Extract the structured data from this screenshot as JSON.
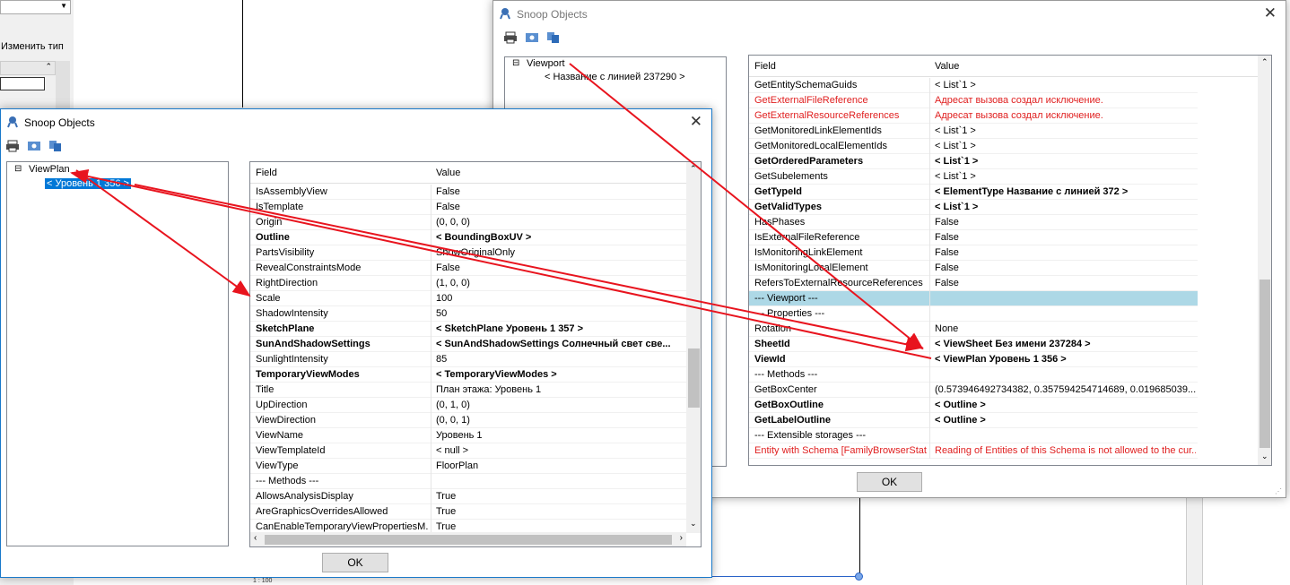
{
  "background": {
    "change_type_label": "Изменить тип",
    "scale_label": "1 : 100"
  },
  "left_window": {
    "title": "Snoop Objects",
    "close": "✕",
    "tree": {
      "root": "ViewPlan",
      "child": "< Уровень 1  356 >",
      "expander": "⊟"
    },
    "headers": {
      "field": "Field",
      "value": "Value"
    },
    "rows": [
      {
        "f": "IsAssemblyView",
        "v": "False",
        "style": ""
      },
      {
        "f": "IsTemplate",
        "v": "False",
        "style": ""
      },
      {
        "f": "Origin",
        "v": "(0, 0, 0)",
        "style": ""
      },
      {
        "f": "Outline",
        "v": "< BoundingBoxUV >",
        "style": "bold"
      },
      {
        "f": "PartsVisibility",
        "v": "ShowOriginalOnly",
        "style": ""
      },
      {
        "f": "RevealConstraintsMode",
        "v": "False",
        "style": ""
      },
      {
        "f": "RightDirection",
        "v": "(1, 0, 0)",
        "style": ""
      },
      {
        "f": "Scale",
        "v": "100",
        "style": ""
      },
      {
        "f": "ShadowIntensity",
        "v": "50",
        "style": ""
      },
      {
        "f": "SketchPlane",
        "v": "< SketchPlane  Уровень 1    357 >",
        "style": "bold"
      },
      {
        "f": "SunAndShadowSettings",
        "v": "< SunAndShadowSettings  Солнечный свет све...",
        "style": "bold"
      },
      {
        "f": "SunlightIntensity",
        "v": "85",
        "style": ""
      },
      {
        "f": "TemporaryViewModes",
        "v": "< TemporaryViewModes >",
        "style": "bold"
      },
      {
        "f": "Title",
        "v": "План этажа: Уровень 1",
        "style": ""
      },
      {
        "f": "UpDirection",
        "v": "(0, 1, 0)",
        "style": ""
      },
      {
        "f": "ViewDirection",
        "v": "(0, 0, 1)",
        "style": ""
      },
      {
        "f": "ViewName",
        "v": "Уровень 1",
        "style": ""
      },
      {
        "f": "ViewTemplateId",
        "v": "< null >",
        "style": ""
      },
      {
        "f": "ViewType",
        "v": "FloorPlan",
        "style": ""
      },
      {
        "f": "--- Methods ---",
        "v": "",
        "style": "section"
      },
      {
        "f": "AllowsAnalysisDisplay",
        "v": "True",
        "style": ""
      },
      {
        "f": "AreGraphicsOverridesAllowed",
        "v": "True",
        "style": ""
      },
      {
        "f": "CanEnableTemporaryViewPropertiesM...",
        "v": "True",
        "style": ""
      }
    ],
    "ok_label": "OK"
  },
  "right_window": {
    "title": "Snoop Objects",
    "close": "✕",
    "tree": {
      "root": "Viewport",
      "child": "< Название с линией  237290 >",
      "expander": "⊟"
    },
    "headers": {
      "field": "Field",
      "value": "Value"
    },
    "rows": [
      {
        "f": "GetEntitySchemaGuids",
        "v": "< List`1 >",
        "style": ""
      },
      {
        "f": "GetExternalFileReference",
        "v": "Адресат вызова создал исключение.",
        "style": "red"
      },
      {
        "f": "GetExternalResourceReferences",
        "v": "Адресат вызова создал исключение.",
        "style": "red"
      },
      {
        "f": "GetMonitoredLinkElementIds",
        "v": "< List`1 >",
        "style": ""
      },
      {
        "f": "GetMonitoredLocalElementIds",
        "v": "< List`1 >",
        "style": ""
      },
      {
        "f": "GetOrderedParameters",
        "v": "< List`1 >",
        "style": "bold"
      },
      {
        "f": "GetSubelements",
        "v": "< List`1 >",
        "style": ""
      },
      {
        "f": "GetTypeId",
        "v": "< ElementType  Название с линией    372 >",
        "style": "bold"
      },
      {
        "f": "GetValidTypes",
        "v": "< List`1 >",
        "style": "bold"
      },
      {
        "f": "HasPhases",
        "v": "False",
        "style": ""
      },
      {
        "f": "IsExternalFileReference",
        "v": "False",
        "style": ""
      },
      {
        "f": "IsMonitoringLinkElement",
        "v": "False",
        "style": ""
      },
      {
        "f": "IsMonitoringLocalElement",
        "v": "False",
        "style": ""
      },
      {
        "f": "RefersToExternalResourceReferences",
        "v": "False",
        "style": ""
      },
      {
        "f": "--- Viewport ---",
        "v": "",
        "style": "hl"
      },
      {
        "f": "  --- Properties ---",
        "v": "",
        "style": "section"
      },
      {
        "f": "Rotation",
        "v": "None",
        "style": ""
      },
      {
        "f": "SheetId",
        "v": "< ViewSheet   Без имени   237284 >",
        "style": "bold"
      },
      {
        "f": "ViewId",
        "v": "< ViewPlan  Уровень 1    356 >",
        "style": "bold"
      },
      {
        "f": "  --- Methods ---",
        "v": "",
        "style": "section"
      },
      {
        "f": "GetBoxCenter",
        "v": "(0.573946492734382, 0.357594254714689, 0.019685039...",
        "style": ""
      },
      {
        "f": "GetBoxOutline",
        "v": "< Outline >",
        "style": "bold"
      },
      {
        "f": "GetLabelOutline",
        "v": "< Outline >",
        "style": "bold"
      },
      {
        "f": "--- Extensible storages ---",
        "v": "",
        "style": "section"
      },
      {
        "f": "Entity with Schema [FamilyBrowserStat",
        "v": "Reading of Entities of this Schema is not allowed to the cur...",
        "style": "red"
      }
    ],
    "ok_label": "OK"
  },
  "colors": {
    "arrow": "#e8141e",
    "selection": "#0078d7",
    "highlight": "#add8e6",
    "error": "#e02020"
  }
}
